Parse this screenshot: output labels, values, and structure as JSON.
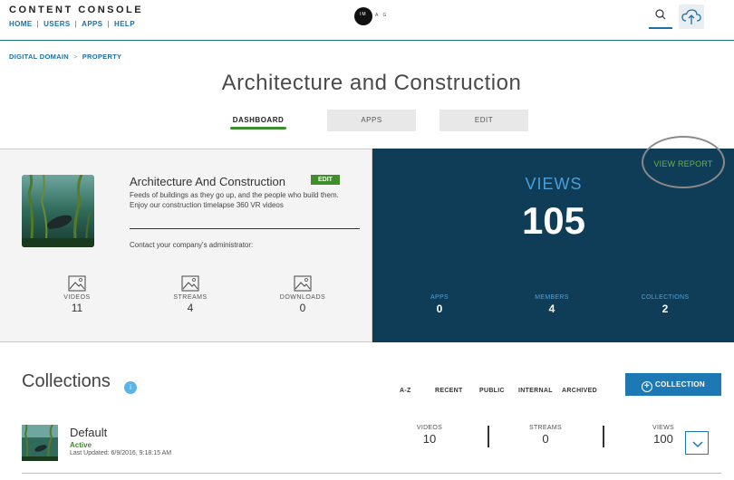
{
  "header": {
    "brand": "CONTENT CONSOLE",
    "nav": [
      "HOME",
      "USERS",
      "APPS",
      "HELP"
    ],
    "logo_mark": "IM",
    "logo_tail": "A G"
  },
  "breadcrumb": [
    "DIGITAL DOMAIN",
    "PROPERTY"
  ],
  "page_title": "Architecture and Construction",
  "tabs": {
    "dashboard": "DASHBOARD",
    "apps": "APPS",
    "edit": "EDIT"
  },
  "property": {
    "name": "Architecture And Construction",
    "edit_label": "EDIT",
    "description": "Feeds of buildings as they go up, and the people who build them. Enjoy our construction timelapse 360 VR videos",
    "contact": "Contact your company's administrator:",
    "stats": [
      {
        "label": "VIDEOS",
        "value": "11"
      },
      {
        "label": "STREAMS",
        "value": "4"
      },
      {
        "label": "DOWNLOADS",
        "value": "0"
      }
    ]
  },
  "views": {
    "view_report": "VIEW REPORT",
    "label": "VIEWS",
    "count": "105",
    "stats": [
      {
        "label": "APPS",
        "value": "0"
      },
      {
        "label": "MEMBERS",
        "value": "4"
      },
      {
        "label": "COLLECTIONS",
        "value": "2"
      }
    ]
  },
  "collections": {
    "title": "Collections",
    "info": "i",
    "sort_options": [
      "A-Z",
      "RECENT",
      "PUBLIC",
      "INTERNAL",
      "ARCHIVED"
    ],
    "add_button": "COLLECTION",
    "rows": [
      {
        "name": "Default",
        "status": "Active",
        "updated": "Last Updated: 6/9/2016, 9:18:15 AM",
        "videos_label": "VIDEOS",
        "videos": "10",
        "streams_label": "STREAMS",
        "streams": "0",
        "views_label": "VIEWS",
        "views": "100"
      }
    ]
  },
  "colors": {
    "accent_blue": "#1e78b4",
    "dark_panel": "#0f3d58",
    "green": "#3e8e2c"
  },
  "icons": [
    "search-icon",
    "cloud-upload-icon",
    "image-icon",
    "plus-circle-icon",
    "chevron-down-icon",
    "info-icon"
  ]
}
